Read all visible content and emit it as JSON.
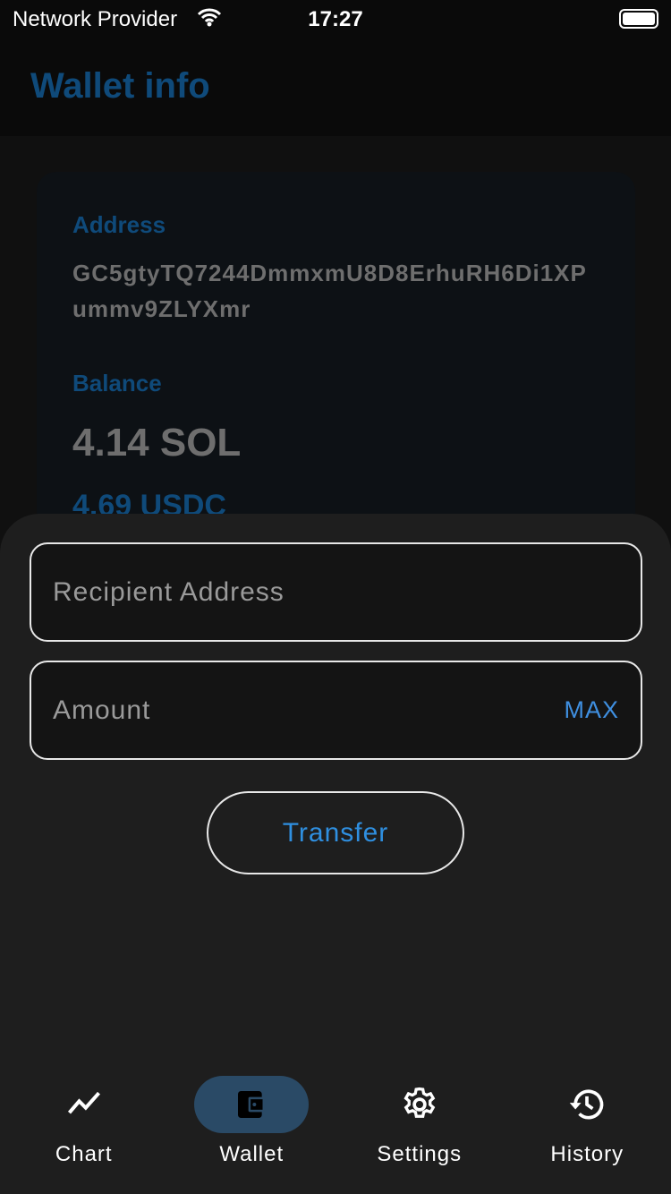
{
  "status": {
    "provider": "Network Provider",
    "time": "17:27"
  },
  "header": {
    "title": "Wallet info"
  },
  "wallet": {
    "address_label": "Address",
    "address": "GC5gtyTQ7244DmmxmU8D8ErhuRH6Di1XPummv9ZLYXmr",
    "balance_label": "Balance",
    "sol": "4.14 SOL",
    "usdc": "4.69 USDC"
  },
  "form": {
    "recipient_placeholder": "Recipient Address",
    "amount_placeholder": "Amount",
    "max_label": "MAX",
    "transfer_label": "Transfer"
  },
  "nav": {
    "items": [
      {
        "label": "Chart",
        "icon": "chart-icon"
      },
      {
        "label": "Wallet",
        "icon": "wallet-icon",
        "active": true
      },
      {
        "label": "Settings",
        "icon": "gear-icon"
      },
      {
        "label": "History",
        "icon": "history-icon"
      }
    ]
  }
}
